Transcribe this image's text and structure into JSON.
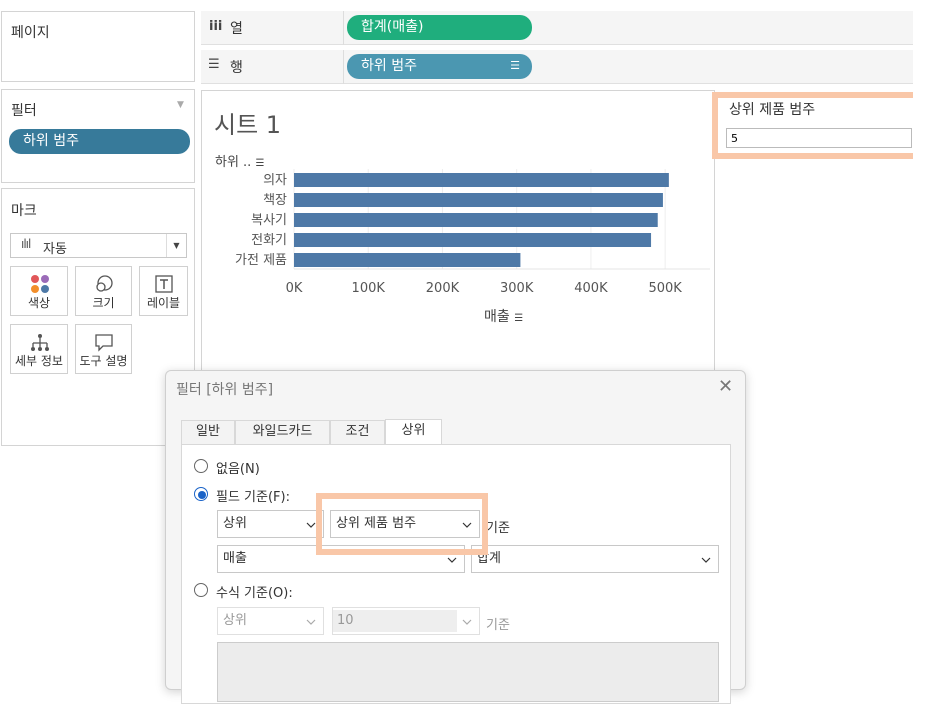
{
  "pages_card": {
    "title": "페이지"
  },
  "shelves": {
    "columns": {
      "icon": "iii",
      "label": "열",
      "pill": "합계(매출)"
    },
    "rows": {
      "icon": "☰",
      "label": "행",
      "pill": "하위 범주"
    }
  },
  "filters_card": {
    "title": "필터",
    "pill": "하위 범주"
  },
  "marks_card": {
    "title": "마크",
    "type_select": "자동",
    "buttons": [
      {
        "label": "색상",
        "icon": "color-dots-icon"
      },
      {
        "label": "크기",
        "icon": "size-circles-icon"
      },
      {
        "label": "레이블",
        "icon": "label-t-icon"
      },
      {
        "label": "세부 정보",
        "icon": "detail-tree-icon"
      },
      {
        "label": "도구 설명",
        "icon": "tooltip-bubble-icon"
      }
    ]
  },
  "sheet": {
    "title": "시트 1",
    "row_header": "하위 ..",
    "x_axis_title": "매출"
  },
  "chart_data": {
    "type": "bar",
    "orientation": "horizontal",
    "categories": [
      "의자",
      "책장",
      "복사기",
      "전화기",
      "가전 제품"
    ],
    "values": [
      505000,
      497000,
      490000,
      481000,
      305000
    ],
    "xlabel": "매출",
    "ylabel": "하위 ..",
    "xlim": [
      0,
      520000
    ],
    "ticks": [
      "0K",
      "100K",
      "200K",
      "300K",
      "400K",
      "500K"
    ],
    "tick_values": [
      0,
      100000,
      200000,
      300000,
      400000,
      500000
    ],
    "bar_color": "#4e79a7"
  },
  "parameter": {
    "title": "상위 제품 범주",
    "value": "5"
  },
  "dialog": {
    "title": "필터 [하위 범주]",
    "tabs": [
      "일반",
      "와일드카드",
      "조건",
      "상위"
    ],
    "active_tab": "상위",
    "radio_none": "없음(N)",
    "radio_field": "필드 기준(F):",
    "field_dir": "상위",
    "field_param": "상위 제품 범주",
    "basis_label": "기준",
    "measure": "매출",
    "aggregation": "합계",
    "radio_formula": "수식 기준(O):",
    "formula_dir": "상위",
    "formula_count": "10",
    "formula_basis": "기준"
  },
  "colors": {
    "accent": "#1a63c8",
    "highlight": "#f9c7a8",
    "green_pill": "#1fae7d",
    "blue_pill": "#4b97b1"
  }
}
